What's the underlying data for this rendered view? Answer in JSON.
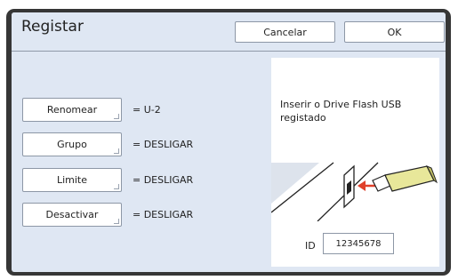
{
  "dialog": {
    "title": "Registar",
    "cancel_label": "Cancelar",
    "ok_label": "OK"
  },
  "settings": [
    {
      "button": "Renomear",
      "value": "= U-2"
    },
    {
      "button": "Grupo",
      "value": "= DESLIGAR"
    },
    {
      "button": "Limite",
      "value": "= DESLIGAR"
    },
    {
      "button": "Desactivar",
      "value": "= DESLIGAR"
    }
  ],
  "info": {
    "message": "Inserir o Drive Flash USB registado",
    "id_label": "ID",
    "id_value": "12345678"
  },
  "colors": {
    "panel_bg": "#dfe7f3",
    "frame": "#363636",
    "usb_body": "#e8e79a",
    "arrow": "#e0402a"
  }
}
